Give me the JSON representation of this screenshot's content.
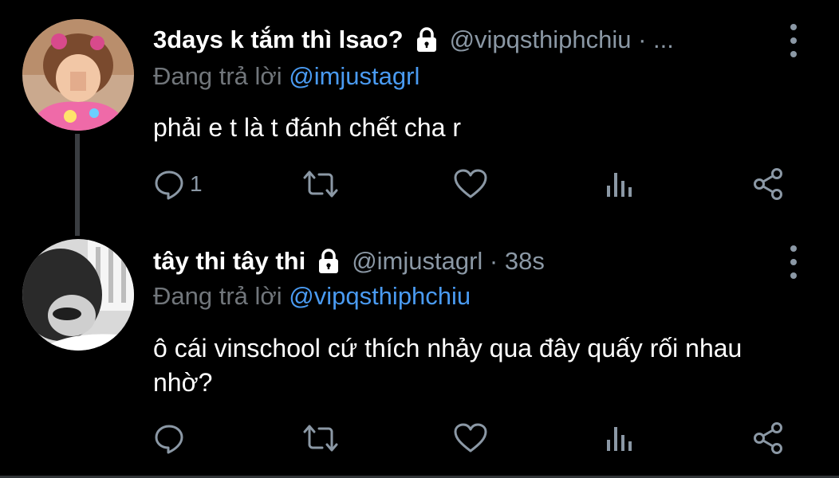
{
  "tweets": [
    {
      "display_name": "3days k tắm thì lsao?",
      "handle_meta": "@vipqsthiphchiu · ...",
      "replying_prefix": "Đang trả lời ",
      "replying_to": "@imjustagrl",
      "text": "phải e t là t đánh chết cha r",
      "reply_count": "1",
      "retweet_count": "",
      "like_count": ""
    },
    {
      "display_name": "tây thi tây thi",
      "handle_meta": "@imjustagrl · 38s",
      "replying_prefix": "Đang trả lời ",
      "replying_to": "@vipqsthiphchiu",
      "text": "ô cái vinschool cứ thích nhảy qua đây quấy rối nhau nhờ?",
      "reply_count": "",
      "retweet_count": "",
      "like_count": ""
    }
  ],
  "icons": {
    "lock": "lock-icon",
    "more": "more-vertical-icon",
    "reply": "comment-icon",
    "retweet": "retweet-icon",
    "like": "heart-icon",
    "views": "analytics-icon",
    "share": "share-icon"
  },
  "colors": {
    "background": "#000000",
    "name": "#ffffff",
    "meta": "#8b98a5",
    "link": "#4a9bf2",
    "thread_line": "#3a3d41"
  }
}
